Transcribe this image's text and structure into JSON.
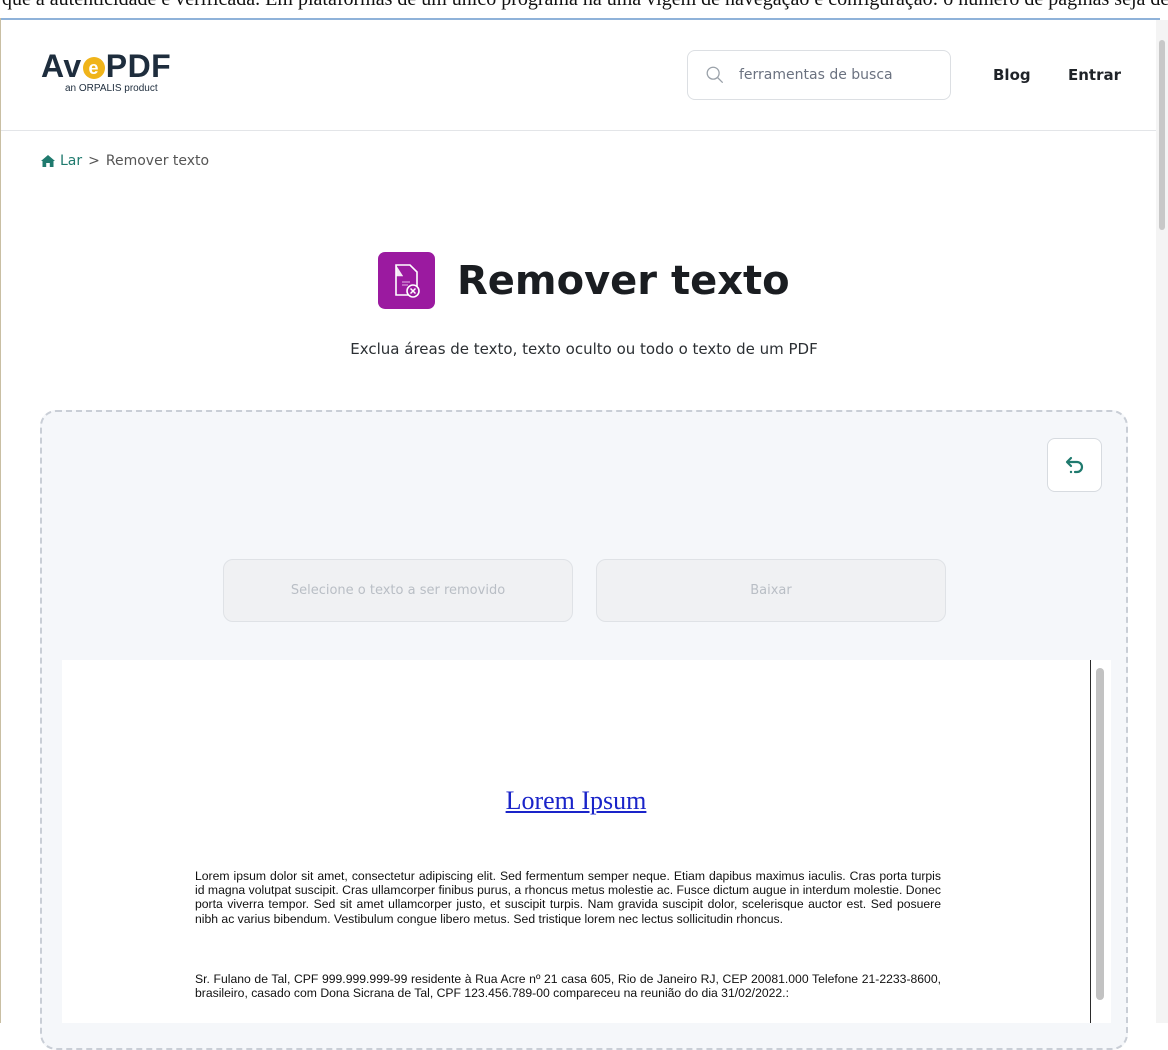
{
  "browser": {
    "overflow_text": "que a autenticidade é verificada. Em plataformas de um único programa há uma vigem de navegação e configuração: o número de páginas seja definido em torno de ferramentas"
  },
  "header": {
    "logo_main_left": "Av",
    "logo_main_e": "e",
    "logo_main_right": "PDF",
    "logo_sub": "an ORPALIS product",
    "search_placeholder": "ferramentas de busca",
    "nav": {
      "blog": "Blog",
      "login": "Entrar"
    }
  },
  "breadcrumb": {
    "home": "Lar",
    "separator": ">",
    "current": "Remover texto"
  },
  "page": {
    "title": "Remover texto",
    "subtitle": "Exclua áreas de texto, texto oculto ou todo o texto de um PDF"
  },
  "tool": {
    "select_button": "Selecione o texto a ser removido",
    "download_button": "Baixar"
  },
  "document": {
    "title": "Lorem Ipsum",
    "paragraph1": "Lorem ipsum dolor sit amet, consectetur adipiscing elit. Sed fermentum semper neque. Etiam dapibus maximus iaculis. Cras porta turpis id magna volutpat suscipit. Cras ullamcorper finibus purus, a rhoncus metus molestie ac. Fusce dictum augue in interdum molestie. Donec porta viverra tempor. Sed sit amet ullamcorper justo, et suscipit turpis. Nam gravida suscipit dolor, scelerisque auctor est. Sed posuere nibh ac varius bibendum. Vestibulum congue libero metus. Sed tristique lorem nec lectus sollicitudin rhoncus.",
    "paragraph2": "Sr. Fulano de Tal, CPF 999.999.999-99 residente à Rua Acre nº 21 casa 605, Rio de Janeiro RJ, CEP 20081.000 Telefone 21-2233-8600, brasileiro, casado com Dona Sicrana de Tal, CPF 123.456.789-00 compareceu na reunião do dia 31/02/2022.:"
  },
  "colors": {
    "accent": "#1f7a6e",
    "tool_icon": "#9b1aa0",
    "logo": "#1e2d3d",
    "logo_e": "#f0b41a",
    "doc_link": "#1a24c9"
  },
  "icons": {
    "search": "search-icon",
    "home": "home-icon",
    "undo": "undo-icon",
    "tool": "remove-text-icon"
  }
}
